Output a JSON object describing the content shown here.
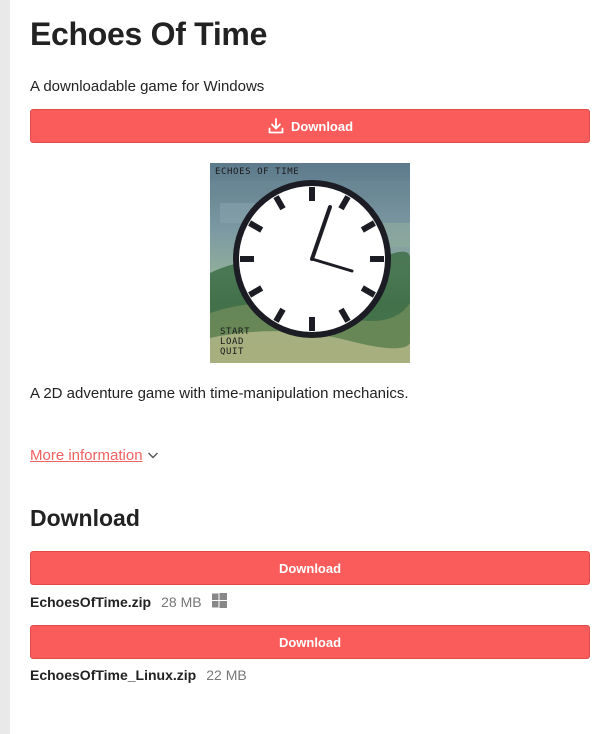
{
  "header": {
    "title": "Echoes Of Time",
    "subtitle": "A downloadable game for Windows"
  },
  "top_download": {
    "label": "Download",
    "icon": "download-icon"
  },
  "cover": {
    "title_text": "ECHOES OF TIME",
    "menu": [
      "START",
      "LOAD",
      "QUIT"
    ],
    "icon": "clock-icon"
  },
  "description": "A 2D adventure game with time-manipulation mechanics.",
  "more_info": {
    "label": "More information",
    "icon": "chevron-down-icon"
  },
  "download_section": {
    "title": "Download",
    "uploads": [
      {
        "button_label": "Download",
        "file_name": "EchoesOfTime.zip",
        "size": "28 MB",
        "platform_icon": "windows-icon"
      },
      {
        "button_label": "Download",
        "file_name": "EchoesOfTime_Linux.zip",
        "size": "22 MB"
      }
    ]
  },
  "colors": {
    "accent": "#fa5c5c",
    "link": "#f06161",
    "text": "#222222",
    "muted": "#777777"
  }
}
